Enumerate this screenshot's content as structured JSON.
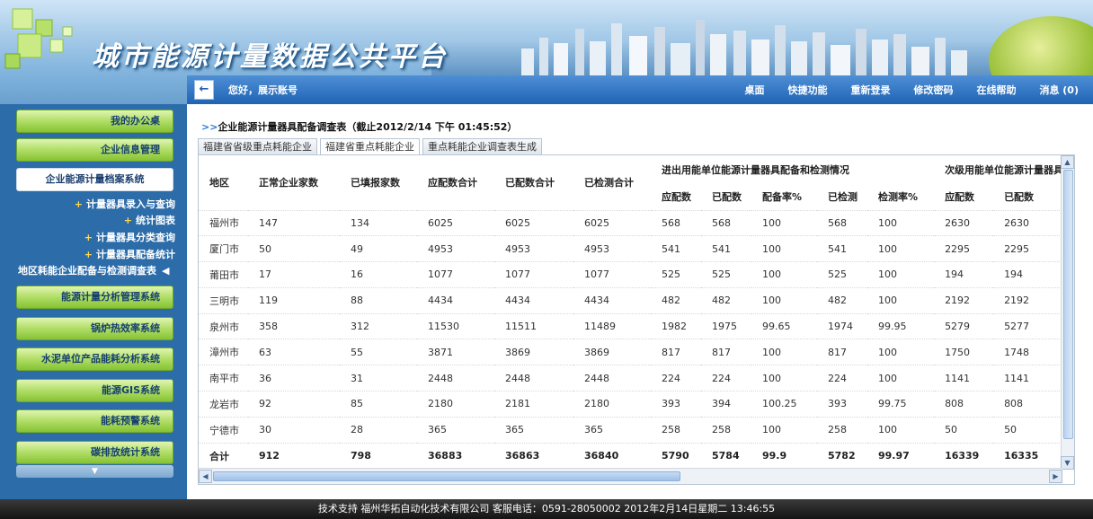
{
  "header": {
    "site_title": "城市能源计量数据公共平台"
  },
  "topnav": {
    "back_icon": "←",
    "greeting": "您好，展示账号",
    "links": [
      "桌面",
      "快捷功能",
      "重新登录",
      "修改密码",
      "在线帮助",
      "消息 (0)"
    ]
  },
  "sidebar": {
    "items_top": [
      "我的办公桌",
      "企业信息管理",
      "企业能源计量档案系统"
    ],
    "subitems": [
      "计量器具录入与查询",
      "统计图表",
      "计量器具分类查询",
      "计量器具配备统计",
      "地区耗能企业配备与检测调查表"
    ],
    "items_bottom": [
      "能源计量分析管理系统",
      "锅炉热效率系统",
      "水泥单位产品能耗分析系统",
      "能源GIS系统",
      "能耗预警系统",
      "碳排放统计系统"
    ],
    "collapse_icon": "▼"
  },
  "content": {
    "title": "企业能源计量器具配备调查表（截止2012/2/14 下午  01:45:52）",
    "tabs": [
      "福建省省级重点耗能企业",
      "福建省重点耗能企业",
      "重点耗能企业调查表生成"
    ],
    "table": {
      "headers_fixed": [
        "地区",
        "正常企业家数",
        "已填报家数",
        "应配数合计",
        "已配数合计",
        "已检测合计"
      ],
      "group1": "进出用能单位能源计量器具配备和检测情况",
      "group2": "次级用能单位能源计量器具配备和检测情况",
      "sub1": [
        "应配数",
        "已配数",
        "配备率%",
        "已检测",
        "检测率%"
      ],
      "sub2": [
        "应配数",
        "已配数"
      ],
      "rows": [
        [
          "福州市",
          "147",
          "134",
          "6025",
          "6025",
          "6025",
          "568",
          "568",
          "100",
          "568",
          "100",
          "2630",
          "2630"
        ],
        [
          "厦门市",
          "50",
          "49",
          "4953",
          "4953",
          "4953",
          "541",
          "541",
          "100",
          "541",
          "100",
          "2295",
          "2295"
        ],
        [
          "莆田市",
          "17",
          "16",
          "1077",
          "1077",
          "1077",
          "525",
          "525",
          "100",
          "525",
          "100",
          "194",
          "194"
        ],
        [
          "三明市",
          "119",
          "88",
          "4434",
          "4434",
          "4434",
          "482",
          "482",
          "100",
          "482",
          "100",
          "2192",
          "2192"
        ],
        [
          "泉州市",
          "358",
          "312",
          "11530",
          "11511",
          "11489",
          "1982",
          "1975",
          "99.65",
          "1974",
          "99.95",
          "5279",
          "5277"
        ],
        [
          "漳州市",
          "63",
          "55",
          "3871",
          "3869",
          "3869",
          "817",
          "817",
          "100",
          "817",
          "100",
          "1750",
          "1748"
        ],
        [
          "南平市",
          "36",
          "31",
          "2448",
          "2448",
          "2448",
          "224",
          "224",
          "100",
          "224",
          "100",
          "1141",
          "1141"
        ],
        [
          "龙岩市",
          "92",
          "85",
          "2180",
          "2181",
          "2180",
          "393",
          "394",
          "100.25",
          "393",
          "99.75",
          "808",
          "808"
        ],
        [
          "宁德市",
          "30",
          "28",
          "365",
          "365",
          "365",
          "258",
          "258",
          "100",
          "258",
          "100",
          "50",
          "50"
        ],
        [
          "合计",
          "912",
          "798",
          "36883",
          "36863",
          "36840",
          "5790",
          "5784",
          "99.9",
          "5782",
          "99.97",
          "16339",
          "16335"
        ]
      ]
    }
  },
  "scroll": {
    "up": "▲",
    "down": "▼",
    "left": "◀",
    "right": "▶"
  },
  "footer": {
    "text": "技术支持  福州华拓自动化技术有限公司  客服电话：0591-28050002  2012年2月14日星期二  13:46:55"
  }
}
